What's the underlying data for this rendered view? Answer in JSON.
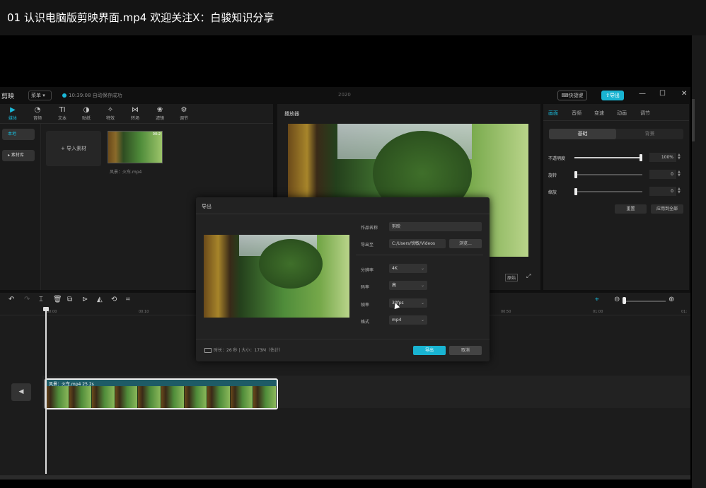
{
  "video_title": "01 认识电脑版剪映界面.mp4  欢迎关注X：白骏知识分享",
  "app": {
    "logo": "剪映",
    "menu_label": "菜单",
    "save_status": "10:39:08 自动保存成功",
    "project_name": "2020",
    "shortcut_label": "快捷键",
    "export_label": "导出",
    "window_controls": [
      "—",
      "☐",
      "✕"
    ]
  },
  "media": {
    "tools": [
      {
        "icon": "▶",
        "label": "媒体"
      },
      {
        "icon": "◔",
        "label": "音频"
      },
      {
        "icon": "TI",
        "label": "文本"
      },
      {
        "icon": "◑",
        "label": "贴纸"
      },
      {
        "icon": "✧",
        "label": "特效"
      },
      {
        "icon": "⋈",
        "label": "转场"
      },
      {
        "icon": "❀",
        "label": "滤镜"
      },
      {
        "icon": "⚙",
        "label": "调节"
      }
    ],
    "side_items": [
      "本地",
      "▸ 素材库"
    ],
    "import_label": "+  导入素材",
    "clip_duration": "00:2",
    "clip_name": "风景：火车.mp4"
  },
  "player": {
    "title": "播放器",
    "ratio_label": "原始"
  },
  "properties": {
    "tabs": [
      "画面",
      "音频",
      "变速",
      "动画",
      "调节"
    ],
    "segments": [
      "基础",
      "背景"
    ],
    "rows": [
      {
        "label": "不透明度",
        "value": "100%",
        "level": 1.0
      },
      {
        "label": "旋转",
        "value": "0",
        "level": 0.0
      },
      {
        "label": "缩放",
        "value": "0",
        "level": 0.0
      }
    ],
    "reset_label": "重置",
    "apply_all_label": "应用到全部"
  },
  "timeline": {
    "ruler_ticks": [
      "00:00",
      "00:10",
      "00:50",
      "01:00",
      "01:"
    ],
    "clip_label": "风景：火车.mp4   25.2s",
    "track_icon": "◀"
  },
  "export_dialog": {
    "title": "导出",
    "fields": [
      {
        "label": "作品名称",
        "value": "剪映"
      },
      {
        "label": "导出至",
        "value": "C:/Users/锐敏/Videos"
      }
    ],
    "browse_label": "浏览...",
    "settings": [
      {
        "label": "分辨率",
        "value": "4K"
      },
      {
        "label": "码率",
        "value": "高"
      },
      {
        "label": "帧率",
        "value": "30fps"
      },
      {
        "label": "格式",
        "value": "mp4"
      }
    ],
    "footer_info": "时长：26 秒  |  大小：173M（估计）",
    "export_label": "导出",
    "cancel_label": "取消"
  },
  "colors": {
    "accent": "#19b4d2",
    "panel_bg": "#1c1c1c",
    "window_bg": "#101010"
  }
}
